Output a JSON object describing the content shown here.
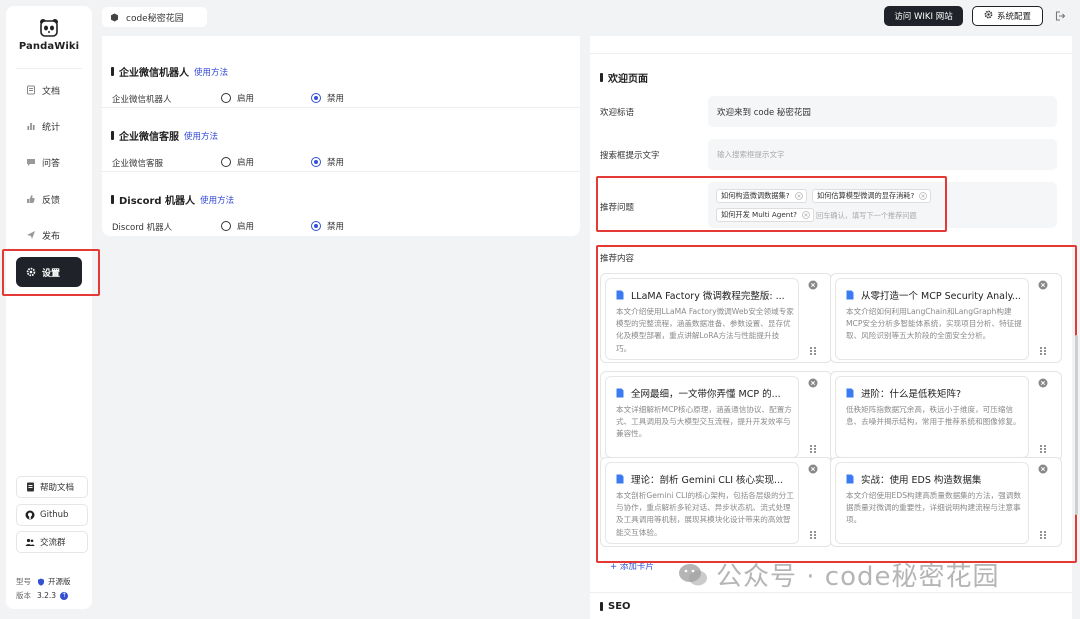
{
  "brand": {
    "name": "PandaWiki"
  },
  "sidebar": {
    "items": [
      {
        "label": "文档",
        "icon": "document-icon"
      },
      {
        "label": "统计",
        "icon": "bar-chart-icon"
      },
      {
        "label": "问答",
        "icon": "chat-bubble-icon"
      },
      {
        "label": "反馈",
        "icon": "thumbs-up-icon"
      },
      {
        "label": "发布",
        "icon": "send-icon"
      },
      {
        "label": "设置",
        "icon": "gear-icon",
        "active": true
      }
    ],
    "footer": {
      "help": "帮助文档",
      "github": "Github",
      "community": "交流群",
      "model_label": "型号",
      "model_value": "开源版",
      "version_label": "版本",
      "version_value": "3.2.3"
    }
  },
  "topbar": {
    "site_name": "code秘密花园",
    "visit_label": "访问 WIKI 网站",
    "config_label": "系统配置"
  },
  "bots": [
    {
      "title": "企业微信机器人",
      "howto": "使用方法",
      "row_label": "企业微信机器人",
      "enable": "启用",
      "disable": "禁用",
      "selected": "disable"
    },
    {
      "title": "企业微信客服",
      "howto": "使用方法",
      "row_label": "企业微信客服",
      "enable": "启用",
      "disable": "禁用",
      "selected": "disable"
    },
    {
      "title": "Discord 机器人",
      "howto": "使用方法",
      "row_label": "Discord 机器人",
      "enable": "启用",
      "disable": "禁用",
      "selected": "disable"
    }
  ],
  "welcome": {
    "section_title": "欢迎页面",
    "slogan_label": "欢迎标语",
    "slogan_value": "欢迎来到 code 秘密花园",
    "search_label": "搜索框提示文字",
    "search_placeholder": "输入搜索框提示文字",
    "questions_label": "推荐问题",
    "questions": [
      "如何构造微调数据集?",
      "如何估算模型微调的显存消耗?",
      "如何开发 Multi Agent?"
    ],
    "questions_hint": "回车确认，填写下一个推荐问题",
    "recommend_label": "推荐内容",
    "cards": [
      {
        "title": "LLaMA Factory 微调教程完整版: ...",
        "desc": "本文介绍使用LLaMA Factory微调Web安全领域专家模型的完整流程，涵盖数据准备、参数设置、显存优化及模型部署，重点讲解LoRA方法与性能提升技巧。"
      },
      {
        "title": "从零打造一个 MCP Security Analy...",
        "desc": "本文介绍如何利用LangChain和LangGraph构建MCP安全分析多智能体系统，实现项目分析、特征提取、风险识别等五大阶段的全面安全分析。"
      },
      {
        "title": "全网最细，一文带你弄懂 MCP 的...",
        "desc": "本文详细解析MCP核心原理，涵盖通信协议、配置方式、工具调用及与大模型交互流程，提升开发效率与兼容性。"
      },
      {
        "title": "进阶：什么是低秩矩阵?",
        "desc": "低秩矩阵指数据冗余高，秩远小于维度，可压缩信息、去噪并揭示结构，常用于推荐系统和图像修复。"
      },
      {
        "title": "理论：剖析 Gemini CLI 核心实现...",
        "desc": "本文剖析Gemini CLI的核心架构，包括各层级的分工与协作，重点解析多轮对话、异步状态机、流式处理及工具调用等机制，展现其模块化设计带来的高效智能交互体验。"
      },
      {
        "title": "实战：使用 EDS 构造数据集",
        "desc": "本文介绍使用EDS构建高质量数据集的方法，强调数据质量对微调的重要性，详细说明构建流程与注意事项。"
      }
    ],
    "add_card": "+ 添加卡片"
  },
  "seo": {
    "title": "SEO"
  },
  "watermark": {
    "text": "公众号 · code秘密花园"
  },
  "colors": {
    "accent": "#3451d1",
    "dark": "#1f2329",
    "highlight_red": "#e53935"
  }
}
